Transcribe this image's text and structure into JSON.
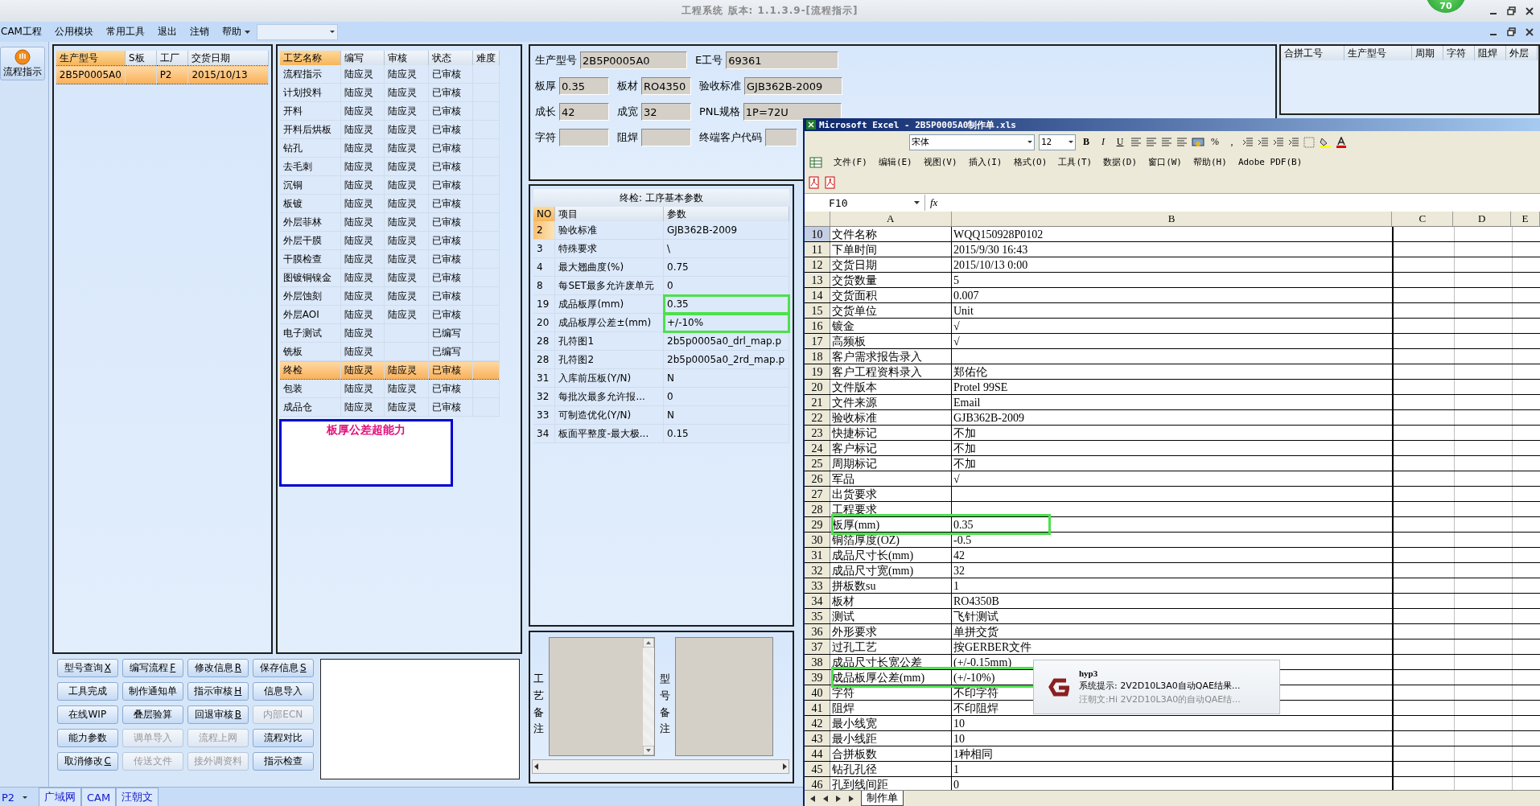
{
  "window": {
    "title": "工程系统 版本: 1.1.3.9-[流程指示]",
    "badge": "70"
  },
  "menu": {
    "items": [
      "CAM工程",
      "公用模块",
      "常用工具",
      "退出",
      "注销",
      "帮助"
    ]
  },
  "sidebar": {
    "items": [
      {
        "label": "流程指示",
        "selected": true
      }
    ]
  },
  "products_table": {
    "columns": [
      "生产型号",
      "S板",
      "工厂",
      "交货日期"
    ],
    "rows": [
      {
        "model": "2B5P0005A0",
        "factory": "P2",
        "date": "2015/10/13",
        "selected": true
      }
    ]
  },
  "process_table": {
    "columns": [
      "工艺名称",
      "编写",
      "审核",
      "状态",
      "难度"
    ],
    "rows": [
      {
        "name": "流程指示",
        "writer": "陆应灵",
        "reviewer": "陆应灵",
        "status": "已审核",
        "selected": false
      },
      {
        "name": "计划投料",
        "writer": "陆应灵",
        "reviewer": "陆应灵",
        "status": "已审核",
        "selected": false
      },
      {
        "name": "开料",
        "writer": "陆应灵",
        "reviewer": "陆应灵",
        "status": "已审核",
        "selected": false
      },
      {
        "name": "开料后烘板",
        "writer": "陆应灵",
        "reviewer": "陆应灵",
        "status": "已审核",
        "selected": false
      },
      {
        "name": "钻孔",
        "writer": "陆应灵",
        "reviewer": "陆应灵",
        "status": "已审核",
        "selected": false
      },
      {
        "name": "去毛刺",
        "writer": "陆应灵",
        "reviewer": "陆应灵",
        "status": "已审核",
        "selected": false
      },
      {
        "name": "沉铜",
        "writer": "陆应灵",
        "reviewer": "陆应灵",
        "status": "已审核",
        "selected": false
      },
      {
        "name": "板镀",
        "writer": "陆应灵",
        "reviewer": "陆应灵",
        "status": "已审核",
        "selected": false
      },
      {
        "name": "外层菲林",
        "writer": "陆应灵",
        "reviewer": "陆应灵",
        "status": "已审核",
        "selected": false
      },
      {
        "name": "外层干膜",
        "writer": "陆应灵",
        "reviewer": "陆应灵",
        "status": "已审核",
        "selected": false
      },
      {
        "name": "干膜检查",
        "writer": "陆应灵",
        "reviewer": "陆应灵",
        "status": "已审核",
        "selected": false
      },
      {
        "name": "图镀铜镍金",
        "writer": "陆应灵",
        "reviewer": "陆应灵",
        "status": "已审核",
        "selected": false
      },
      {
        "name": "外层蚀刻",
        "writer": "陆应灵",
        "reviewer": "陆应灵",
        "status": "已审核",
        "selected": false
      },
      {
        "name": "外层AOI",
        "writer": "陆应灵",
        "reviewer": "陆应灵",
        "status": "已审核",
        "selected": false
      },
      {
        "name": "电子测试",
        "writer": "陆应灵",
        "status": "已编写",
        "selected": false
      },
      {
        "name": "铣板",
        "writer": "陆应灵",
        "status": "已编写",
        "selected": false
      },
      {
        "name": "终检",
        "writer": "陆应灵",
        "reviewer": "陆应灵",
        "status": "已审核",
        "selected": true
      },
      {
        "name": "包装",
        "writer": "陆应灵",
        "reviewer": "陆应灵",
        "status": "已审核",
        "selected": false
      },
      {
        "name": "成品仓",
        "writer": "陆应灵",
        "reviewer": "陆应灵",
        "status": "已审核",
        "selected": false
      }
    ]
  },
  "warning_note": {
    "text": "板厚公差超能力"
  },
  "buttons": [
    {
      "label": "型号查询",
      "shortcut": "X",
      "disabled": false
    },
    {
      "label": "编写流程",
      "shortcut": "F",
      "disabled": false
    },
    {
      "label": "修改信息",
      "shortcut": "R",
      "disabled": false
    },
    {
      "label": "保存信息",
      "shortcut": "S",
      "disabled": false
    },
    {
      "label": "工具完成",
      "disabled": false
    },
    {
      "label": "制作通知单",
      "disabled": false
    },
    {
      "label": "指示审核",
      "shortcut": "H",
      "disabled": false
    },
    {
      "label": "信息导入",
      "disabled": false
    },
    {
      "label": "在线WIP",
      "disabled": false
    },
    {
      "label": "叠层验算",
      "disabled": false
    },
    {
      "label": "回退审核",
      "shortcut": "B",
      "disabled": false
    },
    {
      "label": "内部ECN",
      "disabled": true
    },
    {
      "label": "能力参数",
      "disabled": false
    },
    {
      "label": "调单导入",
      "disabled": true
    },
    {
      "label": "流程上网",
      "disabled": true
    },
    {
      "label": "流程对比",
      "disabled": false
    },
    {
      "label": "取消修改",
      "shortcut": "C",
      "disabled": false
    },
    {
      "label": "传送文件",
      "disabled": true
    },
    {
      "label": "接外调资料",
      "disabled": true
    },
    {
      "label": "指示检查",
      "disabled": false
    }
  ],
  "product_form": {
    "top_fields": [
      {
        "label": "生产型号",
        "value": "2B5P0005A0"
      },
      {
        "label": "E工号",
        "value": "69361"
      }
    ],
    "rows": [
      [
        {
          "label": "板厚",
          "value": "0.35"
        },
        {
          "label": "板材",
          "value": "RO4350"
        },
        {
          "label": "验收标准",
          "value": "GJB362B-2009"
        }
      ],
      [
        {
          "label": "成长",
          "value": "42"
        },
        {
          "label": "成宽",
          "value": "32"
        },
        {
          "label": "PNL规格",
          "value": "1P=72U"
        }
      ],
      [
        {
          "label": "字符"
        },
        {
          "label": "阻焊"
        },
        {
          "label": "终端客户代码"
        }
      ]
    ]
  },
  "merge_table": {
    "columns": [
      "合拼工号",
      "生产型号",
      "周期",
      "字符",
      "阻焊",
      "外层"
    ]
  },
  "param_table": {
    "title": "终检: 工序基本参数",
    "columns": [
      "NO",
      "项目",
      "参数"
    ],
    "rows": [
      {
        "no": "2",
        "item": "验收标准",
        "value": "GJB362B-2009",
        "selected": true,
        "highlighted": false
      },
      {
        "no": "3",
        "item": "特殊要求",
        "value": "\\",
        "selected": false,
        "highlighted": false
      },
      {
        "no": "4",
        "item": "最大翘曲度(%)",
        "value": "0.75",
        "selected": false,
        "highlighted": false
      },
      {
        "no": "8",
        "item": "每SET最多允许废单元",
        "value": "0",
        "selected": false,
        "highlighted": false
      },
      {
        "no": "19",
        "item": "成品板厚(mm)",
        "value": "0.35",
        "selected": false,
        "highlighted": true
      },
      {
        "no": "20",
        "item": "成品板厚公差±(mm)",
        "value": "+/-10%",
        "selected": false,
        "highlighted": true
      },
      {
        "no": "28",
        "item": "孔符图1",
        "value": "2b5p0005a0_drl_map.p",
        "selected": false,
        "highlighted": false
      },
      {
        "no": "28",
        "item": "孔符图2",
        "value": "2b5p0005a0_2rd_map.p",
        "selected": false,
        "highlighted": false
      },
      {
        "no": "31",
        "item": "入库前压板(Y/N)",
        "value": "N",
        "selected": false,
        "highlighted": false
      },
      {
        "no": "32",
        "item": "每批次最多允许报...",
        "value": "0",
        "selected": false,
        "highlighted": false
      },
      {
        "no": "33",
        "item": "可制造优化(Y/N)",
        "value": "N",
        "selected": false,
        "highlighted": false
      },
      {
        "no": "34",
        "item": "板面平整度-最大极...",
        "value": "0.15",
        "selected": false,
        "highlighted": false
      }
    ]
  },
  "remarks": [
    {
      "label": "工艺备注"
    },
    {
      "label": "型号备注"
    }
  ],
  "excel": {
    "title": "Microsoft Excel - 2B5P0005A0制作单.xls",
    "font": "宋体",
    "size": "12",
    "format_buttons": [
      "B",
      "I",
      "U"
    ],
    "number_buttons": [
      "%",
      ","
    ],
    "menu": [
      "文件(F)",
      "编辑(E)",
      "视图(V)",
      "插入(I)",
      "格式(O)",
      "工具(T)",
      "数据(D)",
      "窗口(W)",
      "帮助(H)",
      "Adobe PDF(B)"
    ],
    "name_box": "F10",
    "fx": "fx",
    "columns": [
      "A",
      "B",
      "C",
      "D",
      "E"
    ],
    "rows": [
      {
        "row": "10",
        "a": "文件名称",
        "b": "WQQ150928P0102",
        "selected": true,
        "highlighted": false
      },
      {
        "row": "11",
        "a": "下单时间",
        "b": "2015/9/30 16:43",
        "selected": false,
        "highlighted": false
      },
      {
        "row": "12",
        "a": "交货日期",
        "b": "2015/10/13 0:00",
        "selected": false,
        "highlighted": false
      },
      {
        "row": "13",
        "a": "交货数量",
        "b": "5",
        "selected": false,
        "highlighted": false
      },
      {
        "row": "14",
        "a": "交货面积",
        "b": "0.007",
        "selected": false,
        "highlighted": false
      },
      {
        "row": "15",
        "a": "交货单位",
        "b": "Unit",
        "selected": false,
        "highlighted": false
      },
      {
        "row": "16",
        "a": "镀金",
        "b": "√",
        "selected": false,
        "highlighted": false
      },
      {
        "row": "17",
        "a": "高频板",
        "b": "√",
        "selected": false,
        "highlighted": false
      },
      {
        "row": "18",
        "a": "客户需求报告录入",
        "selected": false,
        "highlighted": false
      },
      {
        "row": "19",
        "a": "客户工程资料录入",
        "b": "郑佑伦",
        "selected": false,
        "highlighted": false
      },
      {
        "row": "20",
        "a": "文件版本",
        "b": "Protel 99SE",
        "selected": false,
        "highlighted": false
      },
      {
        "row": "21",
        "a": "文件来源",
        "b": "Email",
        "selected": false,
        "highlighted": false
      },
      {
        "row": "22",
        "a": "验收标准",
        "b": "GJB362B-2009",
        "selected": false,
        "highlighted": false
      },
      {
        "row": "23",
        "a": "快捷标记",
        "b": "不加",
        "selected": false,
        "highlighted": false
      },
      {
        "row": "24",
        "a": "客户标记",
        "b": "不加",
        "selected": false,
        "highlighted": false
      },
      {
        "row": "25",
        "a": "周期标记",
        "b": "不加",
        "selected": false,
        "highlighted": false
      },
      {
        "row": "26",
        "a": "军品",
        "b": "√",
        "selected": false,
        "highlighted": false
      },
      {
        "row": "27",
        "a": "出货要求",
        "selected": false,
        "highlighted": false
      },
      {
        "row": "28",
        "a": "工程要求",
        "selected": false,
        "highlighted": false
      },
      {
        "row": "29",
        "a": "板厚(mm)",
        "b": "0.35",
        "selected": false,
        "highlighted": true
      },
      {
        "row": "30",
        "a": "铜箔厚度(OZ)",
        "b": "-0.5",
        "selected": false,
        "highlighted": false
      },
      {
        "row": "31",
        "a": "成品尺寸长(mm)",
        "b": "42",
        "selected": false,
        "highlighted": false
      },
      {
        "row": "32",
        "a": "成品尺寸宽(mm)",
        "b": "32",
        "selected": false,
        "highlighted": false
      },
      {
        "row": "33",
        "a": "拼板数su",
        "b": "1",
        "selected": false,
        "highlighted": false
      },
      {
        "row": "34",
        "a": "板材",
        "b": "RO4350B",
        "selected": false,
        "highlighted": false
      },
      {
        "row": "35",
        "a": "测试",
        "b": "飞针测试",
        "selected": false,
        "highlighted": false
      },
      {
        "row": "36",
        "a": "外形要求",
        "b": "单拼交货",
        "selected": false,
        "highlighted": false
      },
      {
        "row": "37",
        "a": "过孔工艺",
        "b": "按GERBER文件",
        "selected": false,
        "highlighted": false
      },
      {
        "row": "38",
        "a": "成品尺寸长宽公差",
        "b": "(+/-0.15mm)",
        "selected": false,
        "highlighted": false
      },
      {
        "row": "39",
        "a": "成品板厚公差(mm)",
        "b": "(+/-10%)",
        "selected": false,
        "highlighted": true
      },
      {
        "row": "40",
        "a": "字符",
        "b": "不印字符",
        "selected": false,
        "highlighted": false
      },
      {
        "row": "41",
        "a": "阻焊",
        "b": "不印阻焊",
        "selected": false,
        "highlighted": false
      },
      {
        "row": "42",
        "a": "最小线宽",
        "b": "10",
        "selected": false,
        "highlighted": false
      },
      {
        "row": "43",
        "a": "最小线距",
        "b": "10",
        "selected": false,
        "highlighted": false
      },
      {
        "row": "44",
        "a": "合拼板数",
        "b": "1种相同",
        "selected": false,
        "highlighted": false
      },
      {
        "row": "45",
        "a": "钻孔孔径",
        "b": "1",
        "selected": false,
        "highlighted": false
      },
      {
        "row": "46",
        "a": "孔到线间距",
        "b": "0",
        "selected": false,
        "highlighted": false
      }
    ],
    "sheet_tab": "制作单"
  },
  "notification": {
    "app": "hyp3",
    "message": "系统提示: 2V2D10L3A0自动QAE结果...",
    "preview": "汪朝文:Hi 2V2D10L3A0的自动QAE结..."
  },
  "status_bar": {
    "factory": "P2",
    "items": [
      "广域网",
      "CAM",
      "汪朝文"
    ]
  }
}
